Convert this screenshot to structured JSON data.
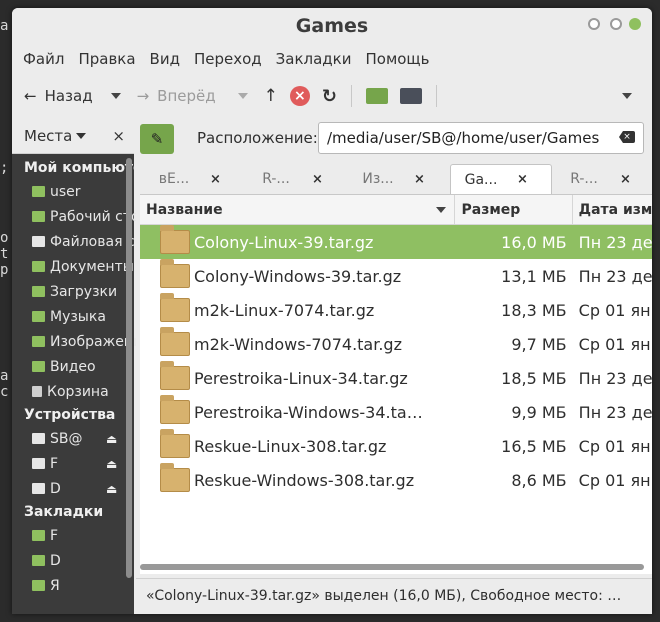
{
  "window": {
    "title": "Games"
  },
  "menubar": [
    "Файл",
    "Правка",
    "Вид",
    "Переход",
    "Закладки",
    "Помощь"
  ],
  "toolbar": {
    "back_label": "Назад",
    "forward_label": "Вперёд"
  },
  "sidebar": {
    "header": "Места",
    "close": "×",
    "sections": [
      {
        "title": "Мой компьютер",
        "items": [
          "user",
          "Рабочий стол",
          "Файловая система",
          "Документы",
          "Загрузки",
          "Музыка",
          "Изображения",
          "Видео",
          "Корзина"
        ]
      },
      {
        "title": "Устройства",
        "items": [
          "SB@",
          "F",
          "D"
        ]
      },
      {
        "title": "Закладки",
        "items": [
          "F",
          "D",
          "Я"
        ]
      }
    ]
  },
  "location": {
    "label": "Расположение:",
    "path": "/media/user/SB@/home/user/Games"
  },
  "tabs": [
    "вЕ...",
    "R-...",
    "Из...",
    "Ga...",
    "R-..."
  ],
  "columns": {
    "name": "Название",
    "size": "Размер",
    "date": "Дата изм"
  },
  "files": [
    {
      "name": "Colony-Linux-39.tar.gz",
      "size": "16,0 МБ",
      "date": "Пн 23 де"
    },
    {
      "name": "Colony-Windows-39.tar.gz",
      "size": "13,1 МБ",
      "date": "Пн 23 де"
    },
    {
      "name": "m2k-Linux-7074.tar.gz",
      "size": "18,3 МБ",
      "date": "Ср 01 ян"
    },
    {
      "name": "m2k-Windows-7074.tar.gz",
      "size": "9,7 МБ",
      "date": "Ср 01 ян"
    },
    {
      "name": "Perestroika-Linux-34.tar.gz",
      "size": "18,5 МБ",
      "date": "Пн 23 де"
    },
    {
      "name": "Perestroika-Windows-34.ta…",
      "size": "9,9 МБ",
      "date": "Пн 23 де"
    },
    {
      "name": "Reskue-Linux-308.tar.gz",
      "size": "16,5 МБ",
      "date": "Ср 01 ян"
    },
    {
      "name": "Reskue-Windows-308.tar.gz",
      "size": "8,6 МБ",
      "date": "Ср 01 ян"
    }
  ],
  "statusbar": "«Colony-Linux-39.tar.gz» выделен (16,0 МБ), Свободное место: …",
  "colors": {
    "accent": "#8fbf62",
    "sidebar_bg": "#3b3b3b",
    "edit_button": "#76a54b"
  }
}
